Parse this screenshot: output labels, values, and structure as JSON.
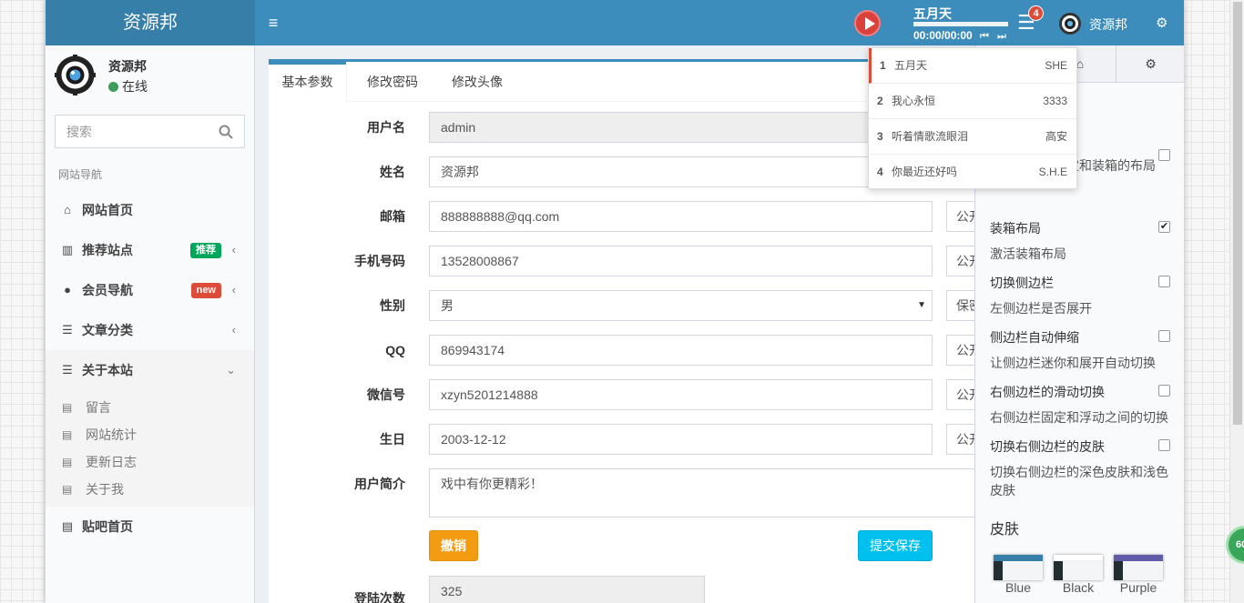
{
  "header": {
    "logo": "资源邦",
    "menu_icon": "≡",
    "music": {
      "title": "五月天",
      "time": "00:00/00:00"
    },
    "notif_count": "4",
    "user_name": "资源邦"
  },
  "sidebar": {
    "user_name": "资源邦",
    "status": "在线",
    "search_placeholder": "搜索",
    "nav_header": "网站导航",
    "items": [
      {
        "label": "网站首页",
        "icon": "home-icon"
      },
      {
        "label": "推荐站点",
        "icon": "bar-chart-icon",
        "badge": "推荐",
        "badge_color": "#00a65a"
      },
      {
        "label": "会员导航",
        "icon": "user-icon",
        "badge": "new",
        "badge_color": "#dd4b39"
      },
      {
        "label": "文章分类",
        "icon": "list-icon"
      },
      {
        "label": "关于本站",
        "icon": "list-icon"
      },
      {
        "label": "贴吧首页",
        "icon": "file-icon"
      }
    ],
    "subitems": [
      "留言",
      "网站统计",
      "更新日志",
      "关于我"
    ]
  },
  "tabs": [
    "基本参数",
    "修改密码",
    "修改头像"
  ],
  "form": {
    "username": {
      "label": "用户名",
      "value": "admin"
    },
    "name": {
      "label": "姓名",
      "value": "资源邦"
    },
    "email": {
      "label": "邮箱",
      "value": "888888888@qq.com",
      "privacy": "公开"
    },
    "phone": {
      "label": "手机号码",
      "value": "13528008867",
      "privacy": "公开"
    },
    "gender": {
      "label": "性别",
      "value": "男",
      "privacy": "保密"
    },
    "qq": {
      "label": "QQ",
      "value": "869943174",
      "privacy": "公开"
    },
    "wechat": {
      "label": "微信号",
      "value": "xzyn5201214888",
      "privacy": "公开"
    },
    "birthday": {
      "label": "生日",
      "value": "2003-12-12",
      "privacy": "公开"
    },
    "bio": {
      "label": "用户简介",
      "value": "戏中有你更精彩！"
    },
    "cancel": "撤销",
    "save": "提交保存",
    "login_count": {
      "label": "登陆次数",
      "value": "325"
    }
  },
  "control": {
    "options": [
      {
        "title": "",
        "desc": "你不能使用固定和装箱的布局",
        "checked": false
      },
      {
        "title": "装箱布局",
        "desc": "激活装箱布局",
        "checked": true
      },
      {
        "title": "切换侧边栏",
        "desc": "左侧边栏是否展开",
        "checked": false
      },
      {
        "title": "侧边栏自动伸缩",
        "desc": "让侧边栏迷你和展开自动切换",
        "checked": false
      },
      {
        "title": "右侧边栏的滑动切换",
        "desc": "右侧边栏固定和浮动之间的切换",
        "checked": false
      },
      {
        "title": "切换右侧边栏的皮肤",
        "desc": "切换右侧边栏的深色皮肤和浅色皮肤",
        "checked": false
      }
    ],
    "skin_header": "皮肤",
    "skins": [
      {
        "name": "Blue",
        "color": "#367fa9"
      },
      {
        "name": "Black",
        "color": "#fefefe"
      },
      {
        "name": "Purple",
        "color": "#605ca8"
      }
    ]
  },
  "playlist": [
    {
      "n": "1",
      "song": "五月天",
      "artist": "SHE"
    },
    {
      "n": "2",
      "song": "我心永恒",
      "artist": "3333"
    },
    {
      "n": "3",
      "song": "听着情歌流眼泪",
      "artist": "高安"
    },
    {
      "n": "4",
      "song": "你最近还好吗",
      "artist": "S.H.E"
    }
  ],
  "floating_badge": "60"
}
